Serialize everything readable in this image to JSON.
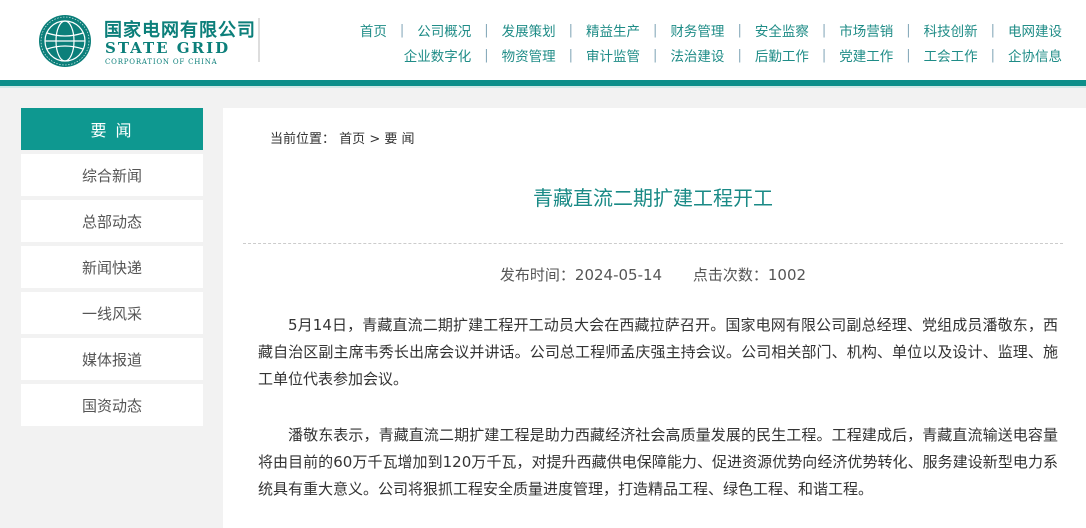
{
  "logo": {
    "cn": "国家电网有限公司",
    "en": "STATE GRID",
    "en_sub": "CORPORATION OF CHINA"
  },
  "nav": {
    "row1": [
      "首页",
      "公司概况",
      "发展策划",
      "精益生产",
      "财务管理",
      "安全监察",
      "市场营销",
      "科技创新",
      "电网建设"
    ],
    "row2": [
      "企业数字化",
      "物资管理",
      "审计监管",
      "法治建设",
      "后勤工作",
      "党建工作",
      "工会工作",
      "企协信息"
    ]
  },
  "sidebar": {
    "title": "要 闻",
    "items": [
      "综合新闻",
      "总部动态",
      "新闻快递",
      "一线风采",
      "媒体报道",
      "国资动态"
    ]
  },
  "breadcrumb": {
    "label": "当前位置：",
    "home": "首页",
    "sep": ">",
    "current": "要 闻"
  },
  "article": {
    "title": "青藏直流二期扩建工程开工",
    "publish": "发布时间：2024-05-14",
    "clicks": "点击次数：1002",
    "p1": "5月14日，青藏直流二期扩建工程开工动员大会在西藏拉萨召开。国家电网有限公司副总经理、党组成员潘敬东，西藏自治区副主席韦秀长出席会议并讲话。公司总工程师孟庆强主持会议。公司相关部门、机构、单位以及设计、监理、施工单位代表参加会议。",
    "p2": "潘敬东表示，青藏直流二期扩建工程是助力西藏经济社会高质量发展的民生工程。工程建成后，青藏直流输送电容量将由目前的60万千瓦增加到120万千瓦，对提升西藏供电保障能力、促进资源优势向经济优势转化、服务建设新型电力系统具有重大意义。公司将狠抓工程安全质量进度管理，打造精品工程、绿色工程、和谐工程。"
  },
  "colors": {
    "brand": "#0c8f8a",
    "sidebar_active": "#0e9890",
    "title": "#1a8a86"
  }
}
